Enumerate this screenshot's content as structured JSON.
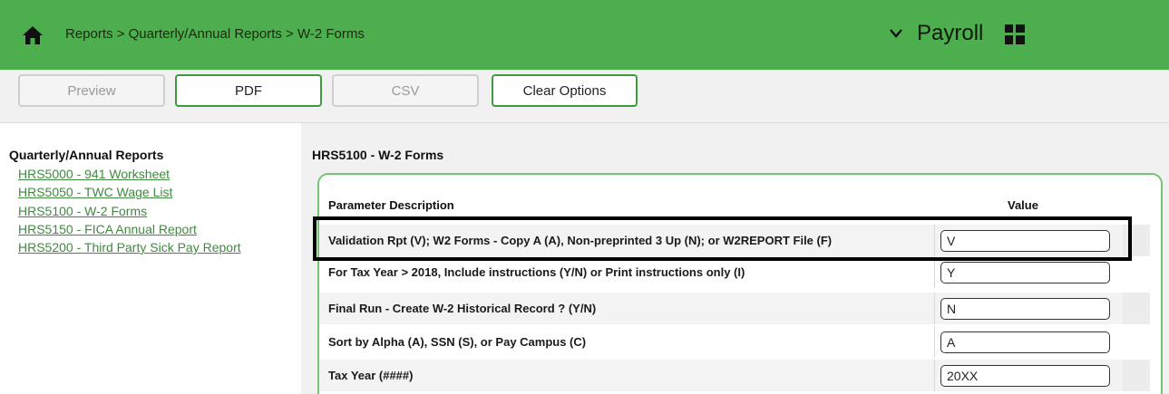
{
  "header": {
    "breadcrumb": "Reports > Quarterly/Annual Reports > W-2 Forms",
    "app_name": "Payroll",
    "icons": [
      "home-icon",
      "chevron-down-icon",
      "grid-icon"
    ],
    "color": "#4cae4c"
  },
  "toolbar": {
    "preview_label": "Preview",
    "pdf_label": "PDF",
    "csv_label": "CSV",
    "clear_label": "Clear Options"
  },
  "sidebar": {
    "title": "Quarterly/Annual Reports",
    "items": [
      {
        "label": "HRS5000 - 941 Worksheet"
      },
      {
        "label": "HRS5050 - TWC Wage List"
      },
      {
        "label": "HRS5100 - W-2 Forms"
      },
      {
        "label": "HRS5150 - FICA Annual Report"
      },
      {
        "label": "HRS5200 - Third Party Sick Pay Report"
      }
    ]
  },
  "main": {
    "title": "HRS5100 - W-2 Forms",
    "col_param": "Parameter Description",
    "col_value": "Value",
    "rows": [
      {
        "label": "Validation Rpt (V); W2 Forms - Copy A (A), Non-preprinted 3 Up (N); or W2REPORT File (F)",
        "value": "V"
      },
      {
        "label": "For Tax Year > 2018, Include instructions (Y/N) or Print instructions only (I)",
        "value": "Y"
      },
      {
        "label": "Final Run - Create W-2 Historical Record ? (Y/N)",
        "value": "N"
      },
      {
        "label": "Sort by Alpha (A), SSN (S), or Pay Campus (C)",
        "value": "A"
      },
      {
        "label": "Tax Year (####)",
        "value": "20XX"
      }
    ]
  }
}
